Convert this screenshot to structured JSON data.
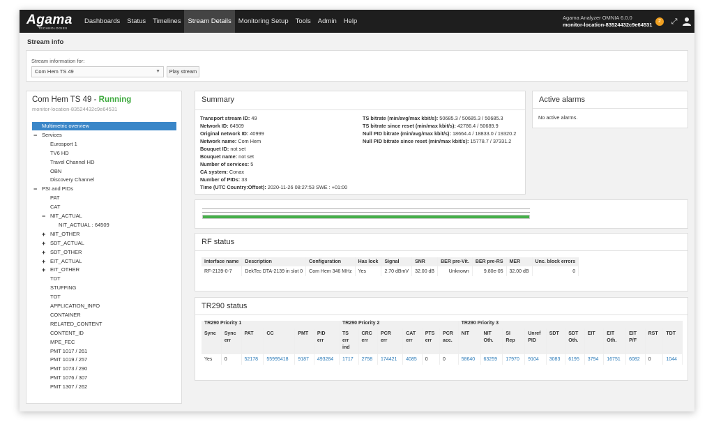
{
  "nav": {
    "logo": "Agama",
    "logo_sub": "TECHNOLOGIES",
    "items": [
      "Dashboards",
      "Status",
      "Timelines",
      "Stream Details",
      "Monitoring Setup",
      "Tools",
      "Admin",
      "Help"
    ],
    "active": "Stream Details",
    "product": "Agama Analyzer OMNIA 6.0.0",
    "location": "monitor-location-83524432c9e64531",
    "alert_count": "2"
  },
  "page": {
    "title": "Stream info"
  },
  "selector": {
    "label": "Stream information for:",
    "value": "Com Hem TS 49",
    "play_label": "Play stream"
  },
  "stream": {
    "name": "Com Hem TS 49",
    "status": "Running",
    "location": "monitor-location-83524432c9e64531"
  },
  "tree": [
    {
      "label": "Multimetric overview",
      "level": 0,
      "selected": true
    },
    {
      "label": "Services",
      "level": 0,
      "toggle": "−"
    },
    {
      "label": "Eurosport 1",
      "level": 1
    },
    {
      "label": "TV6 HD",
      "level": 1
    },
    {
      "label": "Travel Channel HD",
      "level": 1
    },
    {
      "label": "OBN",
      "level": 1
    },
    {
      "label": "Discovery Channel",
      "level": 1
    },
    {
      "label": "PSI and PIDs",
      "level": 0,
      "toggle": "−"
    },
    {
      "label": "PAT",
      "level": 1
    },
    {
      "label": "CAT",
      "level": 1
    },
    {
      "label": "NIT_ACTUAL",
      "level": 1,
      "toggle": "−"
    },
    {
      "label": "NIT_ACTUAL : 64509",
      "level": 2
    },
    {
      "label": "NIT_OTHER",
      "level": 1,
      "toggle": "+"
    },
    {
      "label": "SDT_ACTUAL",
      "level": 1,
      "toggle": "+"
    },
    {
      "label": "SDT_OTHER",
      "level": 1,
      "toggle": "+"
    },
    {
      "label": "EIT_ACTUAL",
      "level": 1,
      "toggle": "+"
    },
    {
      "label": "EIT_OTHER",
      "level": 1,
      "toggle": "+"
    },
    {
      "label": "TDT",
      "level": 1
    },
    {
      "label": "STUFFING",
      "level": 1
    },
    {
      "label": "TOT",
      "level": 1
    },
    {
      "label": "APPLICATION_INFO",
      "level": 1
    },
    {
      "label": "CONTAINER",
      "level": 1
    },
    {
      "label": "RELATED_CONTENT",
      "level": 1
    },
    {
      "label": "CONTENT_ID",
      "level": 1
    },
    {
      "label": "MPE_FEC",
      "level": 1
    },
    {
      "label": "PMT 1017 / 261",
      "level": 1
    },
    {
      "label": "PMT 1019 / 257",
      "level": 1
    },
    {
      "label": "PMT 1073 / 290",
      "level": 1
    },
    {
      "label": "PMT 1076 / 307",
      "level": 1
    },
    {
      "label": "PMT 1307 / 262",
      "level": 1
    }
  ],
  "summary": {
    "title": "Summary",
    "left": [
      {
        "k": "Transport stream ID:",
        "v": "49"
      },
      {
        "k": "Network ID:",
        "v": "64509"
      },
      {
        "k": "Original network ID:",
        "v": "40999"
      },
      {
        "k": "Network name:",
        "v": "Com Hem"
      },
      {
        "k": "Bouquet ID:",
        "v": "not set"
      },
      {
        "k": "Bouquet name:",
        "v": "not set"
      },
      {
        "k": "Number of services:",
        "v": "5"
      },
      {
        "k": "CA system:",
        "v": "Conax"
      },
      {
        "k": "Number of PIDs:",
        "v": "33"
      },
      {
        "k": "Time (UTC Country:Offset):",
        "v": "2020-11-26 08:27:53 SWE : +01:00"
      }
    ],
    "right": [
      {
        "k": "TS bitrate (min/avg/max kbit/s):",
        "v": "50685.3 / 50685.3 / 50685.3"
      },
      {
        "k": "TS bitrate since reset (min/max kbit/s):",
        "v": "42786.4 / 50689.9"
      },
      {
        "k": "Null PID bitrate (min/avg/max kbit/s):",
        "v": "18664.4 / 18833.0 / 19320.2"
      },
      {
        "k": "Null PID bitrate since reset (min/max kbit/s):",
        "v": "15778.7 / 37331.2"
      }
    ]
  },
  "alarms": {
    "title": "Active alarms",
    "text": "No active alarms."
  },
  "bar": {
    "fill": 1.0,
    "color": "#46b04a"
  },
  "rf": {
    "title": "RF status",
    "headers": [
      "Interface name",
      "Description",
      "Configuration",
      "Has lock",
      "Signal",
      "SNR",
      "BER pre-Vit.",
      "BER pre-RS",
      "MER",
      "Unc. block errors"
    ],
    "rows": [
      [
        "RF-2139-0-7",
        "DekTec DTA-2139 in slot 0",
        "Com Hem 346 MHz",
        "Yes",
        "2.70 dBmV",
        "32.00 dB",
        "Unknown",
        "9.80e-05",
        "32.00 dB",
        "0"
      ]
    ]
  },
  "tr290": {
    "title": "TR290 status",
    "groups": [
      "TR290 Priority 1",
      "TR290 Priority 2",
      "TR290 Priority 3"
    ],
    "headers": [
      "Sync",
      "Sync err",
      "PAT",
      "CC",
      "PMT",
      "PID err",
      "TS err ind",
      "CRC err",
      "PCR err",
      "CAT err",
      "PTS err",
      "PCR acc.",
      "NIT",
      "NIT Oth.",
      "SI Rep",
      "Unref PID",
      "SDT",
      "SDT Oth.",
      "EIT",
      "EIT Oth.",
      "EIT P/F",
      "RST",
      "TDT"
    ],
    "values": [
      "Yes",
      "0",
      "52178",
      "55995418",
      "9187",
      "493284",
      "1717",
      "2758",
      "174421",
      "4085",
      "0",
      "0",
      "58640",
      "63259",
      "17970",
      "9104",
      "3083",
      "6195",
      "3794",
      "16751",
      "6082",
      "0",
      "1044"
    ]
  }
}
